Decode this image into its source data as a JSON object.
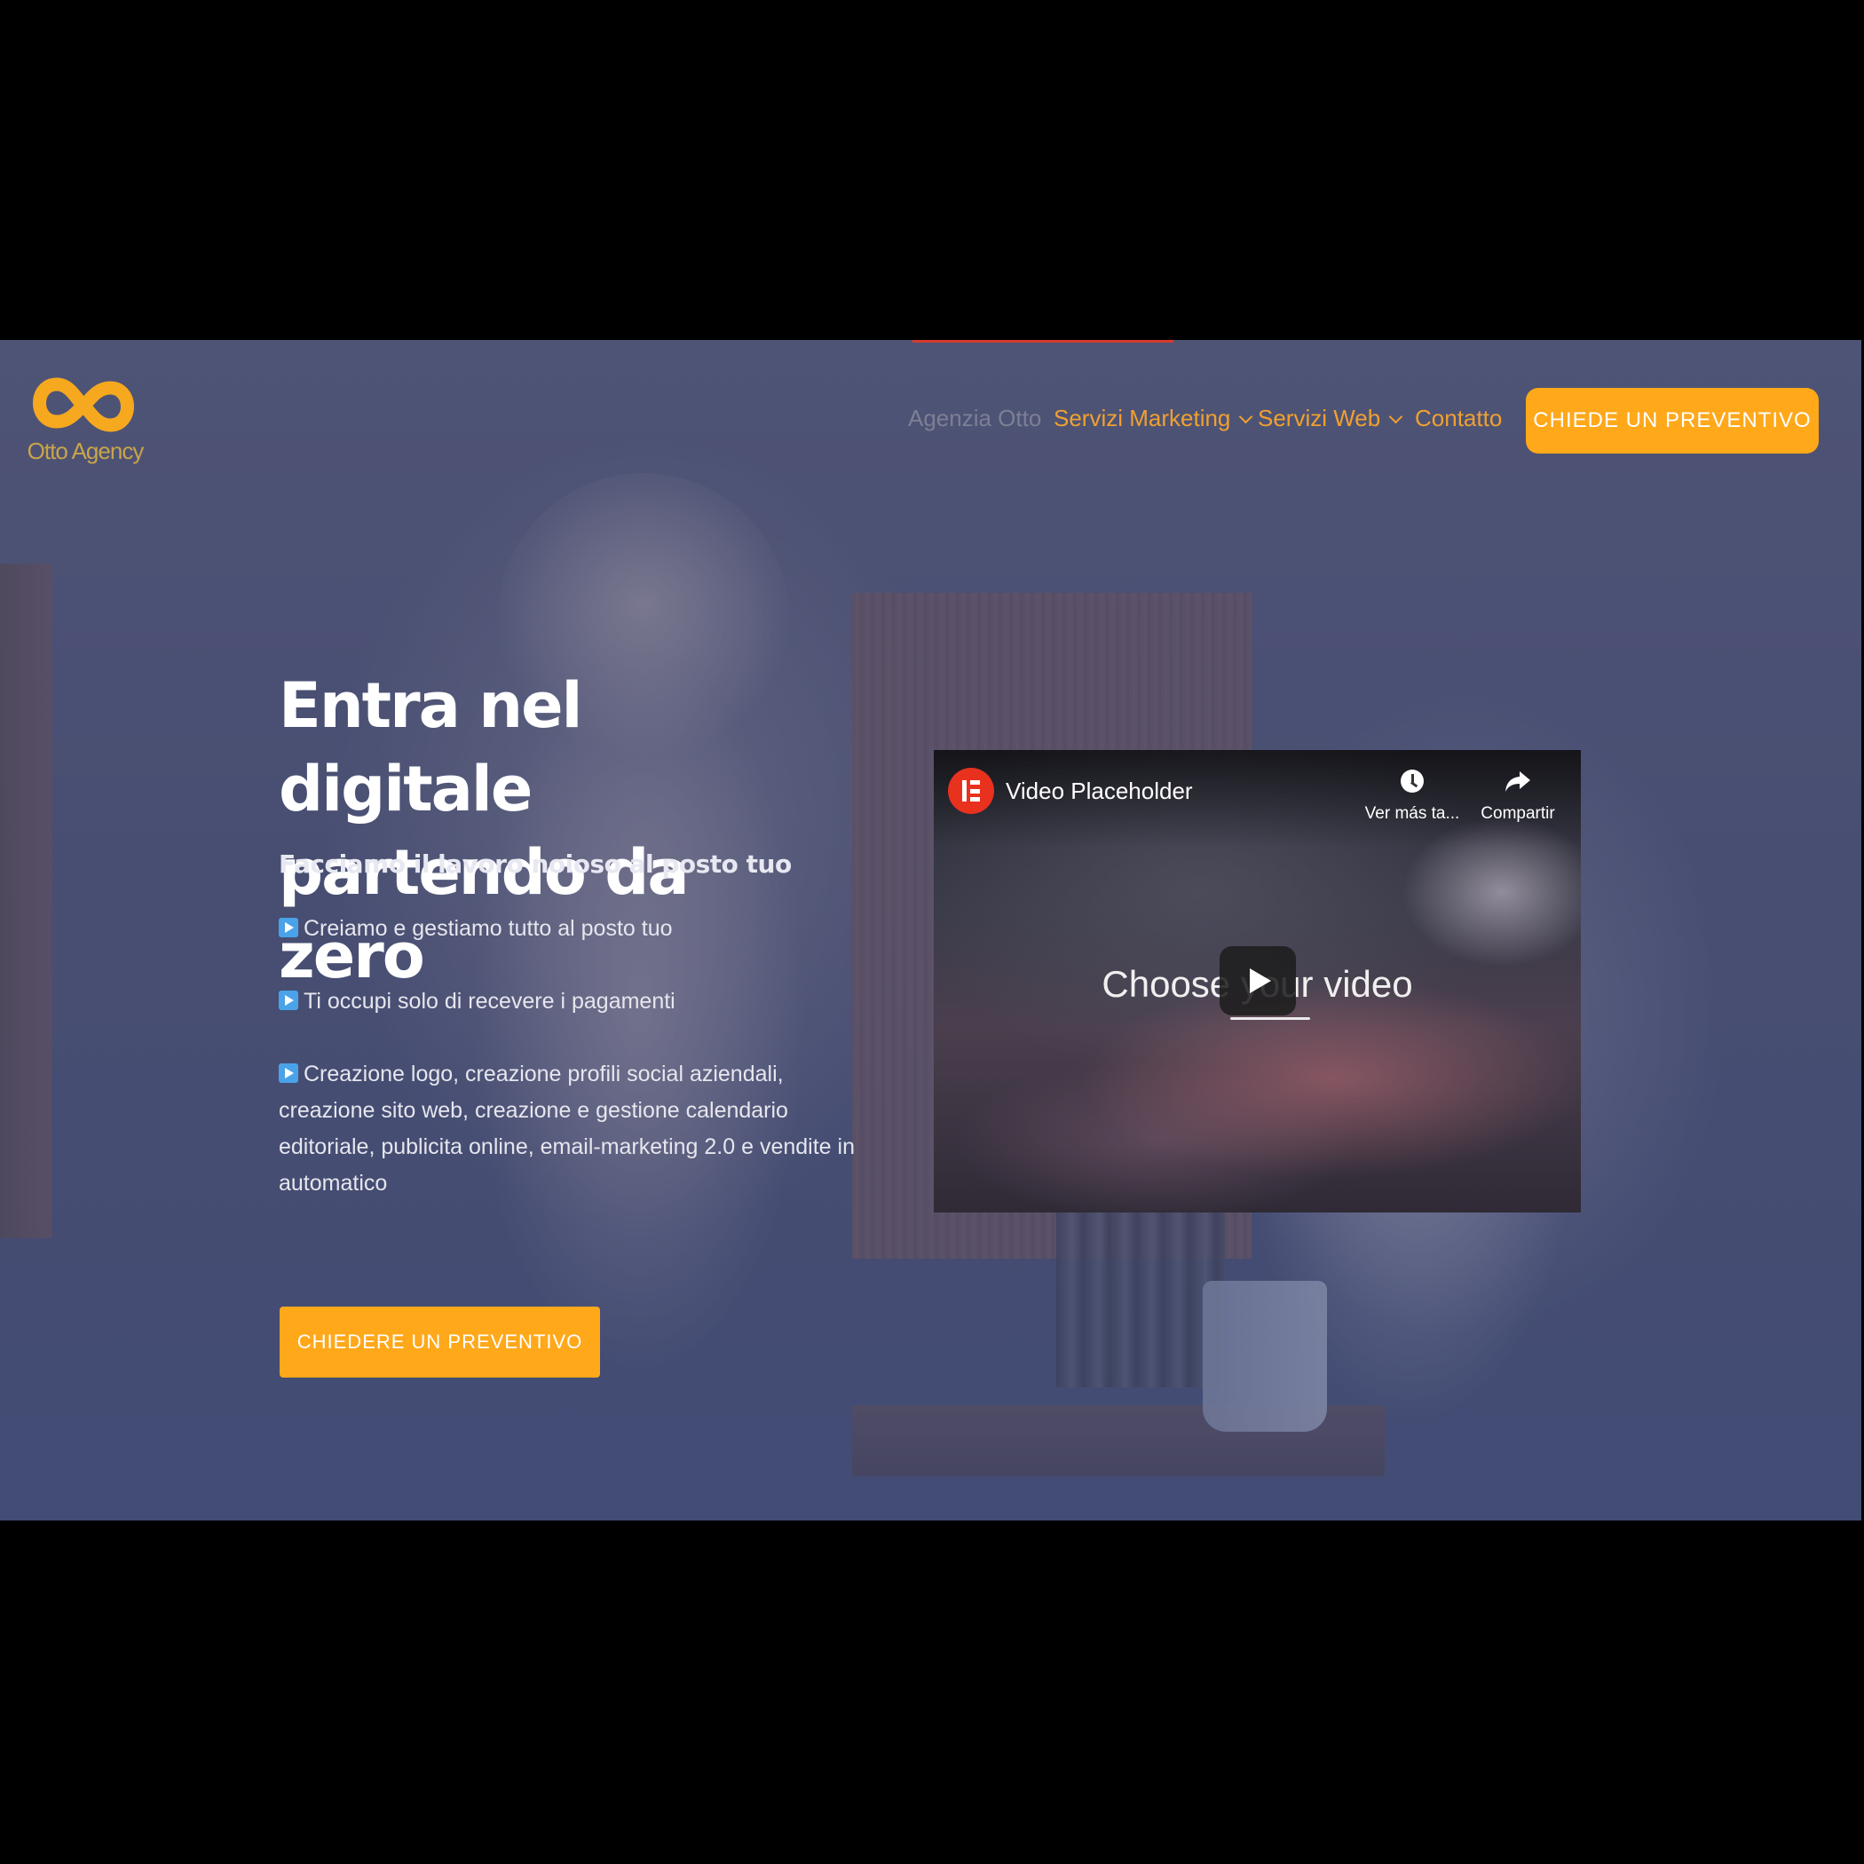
{
  "header": {
    "logo_text": "Otto Agency",
    "nav": {
      "agenzia_label": "Agenzia Otto",
      "marketing_label": "Servizi Marketing",
      "web_label": "Servizi Web",
      "contatto_label": "Contatto"
    },
    "cta_label": "CHIEDE UN PREVENTIVO"
  },
  "hero": {
    "headline_line1": "Entra nel digitale",
    "headline_line2": "partendo da zero",
    "subheadline": "Facciamo il lavoro noioso al posto tuo",
    "bullets": [
      "Creiamo e gestiamo tutto al posto tuo",
      "Ti occupi solo di recevere i pagamenti",
      "Creazione logo, creazione profili social aziendali, creazione sito web, creazione e gestione calendario editoriale, publicita online, email-marketing 2.0 e vendite in automatico"
    ],
    "cta_label": "CHIEDERE UN PREVENTIVO"
  },
  "video": {
    "title": "Video Placeholder",
    "watch_later_label": "Ver más ta...",
    "share_label": "Compartir",
    "center_text": "Choose your video"
  },
  "colors": {
    "accent": "#ffa81a",
    "nav_text": "#f0a030",
    "nav_muted": "#7d7f95",
    "overlay": "#4a4f6e",
    "top_accent": "#d63b2e"
  },
  "icons": {
    "logo": "infinity-logo-icon",
    "bullet": "play-button-emoji-icon",
    "video_channel": "elementor-icon",
    "watch_later": "clock-icon",
    "share": "share-arrow-icon",
    "play": "play-icon"
  }
}
